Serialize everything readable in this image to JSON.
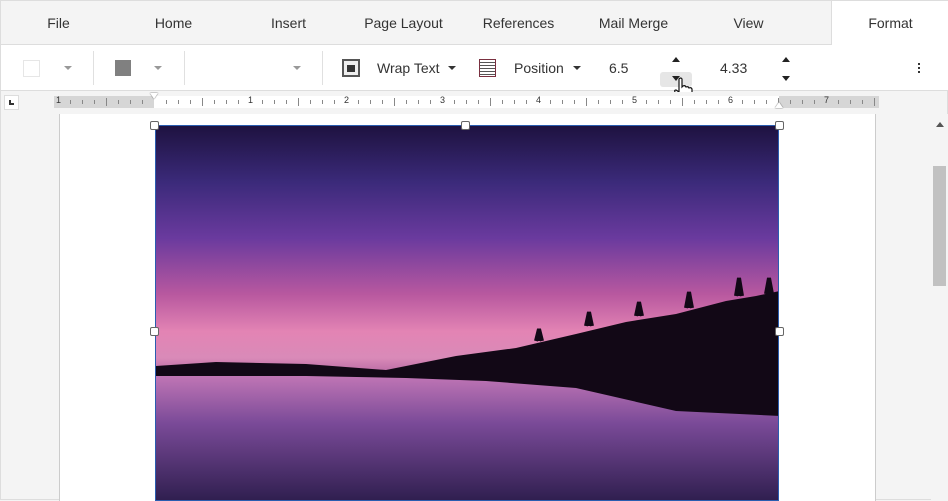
{
  "tabs": [
    "File",
    "Home",
    "Insert",
    "Page Layout",
    "References",
    "Mail Merge",
    "View",
    "Format"
  ],
  "active_tab": "Format",
  "toolbar": {
    "wrap_text_label": "Wrap Text",
    "position_label": "Position",
    "width_value": "6.5",
    "height_value": "4.33",
    "fill_color": "#ffffff",
    "border_color": "#808080"
  },
  "ruler": {
    "labels": [
      "1",
      "1",
      "2",
      "3",
      "4",
      "5",
      "6",
      "7"
    ]
  },
  "colors": {
    "selection": "#2a5db0"
  }
}
